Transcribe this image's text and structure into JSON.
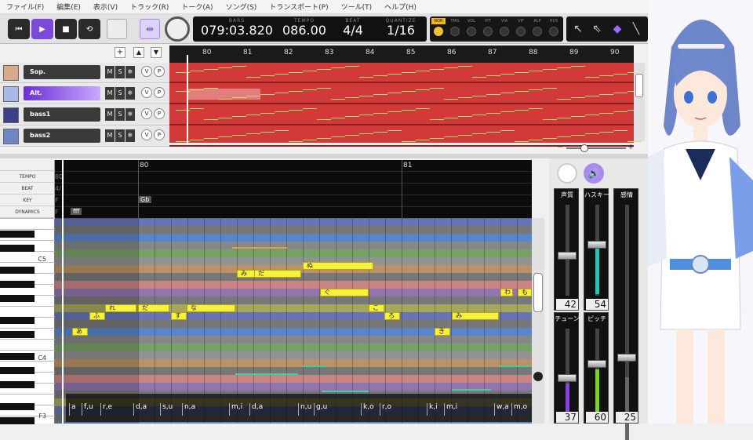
{
  "menu": [
    "ファイル(F)",
    "編集(E)",
    "表示(V)",
    "トラック(R)",
    "トーク(A)",
    "ソング(S)",
    "トランスポート(P)",
    "ツール(T)",
    "ヘルプ(H)"
  ],
  "transport": {
    "bars_label": "BARS",
    "bars_value": "079:03.820",
    "tempo_label": "TEMPO",
    "tempo_value": "086.00",
    "beat_label": "BEAT",
    "beat_value": "4/4",
    "quantize_label": "QUANTIZE",
    "quantize_value": "1/16"
  },
  "param_toggles": [
    "NOR",
    "TMG",
    "VOL",
    "PIT",
    "VIA",
    "VIF",
    "ALP",
    "HUS"
  ],
  "tracks": [
    {
      "name": "Sop.",
      "selected": false
    },
    {
      "name": "Alt.",
      "selected": true
    },
    {
      "name": "bass1",
      "selected": false
    },
    {
      "name": "bass2",
      "selected": false
    }
  ],
  "track_buttons": {
    "mute": "M",
    "solo": "S",
    "freeze": "❄",
    "v": "V",
    "p": "P"
  },
  "top_ruler": [
    "80",
    "81",
    "82",
    "83",
    "84",
    "85",
    "86",
    "87",
    "88",
    "89",
    "90"
  ],
  "row_labels": [
    "TEMPO",
    "BEAT",
    "KEY",
    "DYNAMICS"
  ],
  "editor_ruler": [
    "80",
    "81"
  ],
  "info": {
    "tempo_prefix": "80",
    "beat_prefix": "4/",
    "key_prefix": "F",
    "key_value": "Gb",
    "dyn_prefix": "F",
    "dyn_value": "fff"
  },
  "piano_labels": [
    "C5",
    "C4",
    "F3"
  ],
  "notes": [
    {
      "t": "み"
    },
    {
      "t": "だ"
    },
    {
      "t": "ぬ"
    },
    {
      "t": "ぐ"
    },
    {
      "t": "わ"
    },
    {
      "t": "も"
    },
    {
      "t": "れ"
    },
    {
      "t": "だ"
    },
    {
      "t": "な"
    },
    {
      "t": "こ"
    },
    {
      "t": "ふ"
    },
    {
      "t": "す"
    },
    {
      "t": "ろ"
    },
    {
      "t": "み"
    },
    {
      "t": "あ"
    },
    {
      "t": "き"
    }
  ],
  "lyrics": [
    "a",
    "f,u",
    "r,e",
    "d,a",
    "s,u",
    "n,a",
    "m,i",
    "d,a",
    "n,u",
    "g,u",
    "k,o",
    "r,o",
    "k,i",
    "m,i",
    "w,a",
    "m,o"
  ],
  "sliders": [
    {
      "title": "声質",
      "value": "42",
      "color": "#9a9a9a"
    },
    {
      "title": "ハスキー",
      "value": "54",
      "color": "#22c7b8"
    },
    {
      "title": "感情",
      "value": "",
      "color": "#666"
    },
    {
      "title": "チューン",
      "value": "37",
      "color": "#8a3fe0"
    },
    {
      "title": "ピッチ",
      "value": "60",
      "color": "#7ed321"
    },
    {
      "title": "",
      "value": "25",
      "color": "#e6e01a"
    }
  ],
  "colors": {
    "lane_red": "#d23a3a",
    "note_yellow": "#f6f03e",
    "accent_purple": "#7b4ad8"
  }
}
